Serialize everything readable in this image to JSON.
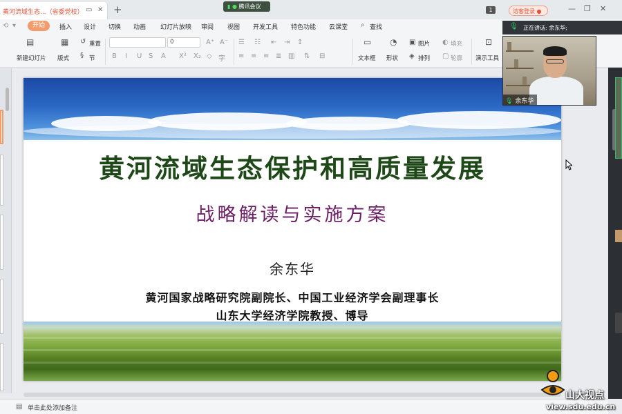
{
  "titlebar": {
    "doc_tab": "黄河流域生态...（省委党校）",
    "new_tab": "+",
    "meeting_badge": "腾讯会议",
    "page_badge": "1",
    "visitor_login": "访客登录"
  },
  "ribbon": {
    "menu": [
      "开始",
      "插入",
      "设计",
      "切换",
      "动画",
      "幻灯片放映",
      "审阅",
      "视图",
      "开发工具",
      "特色功能",
      "云课堂",
      "查找"
    ],
    "active_menu": "开始",
    "tools": {
      "new_slide": "新建幻灯片",
      "layout": "版式",
      "reset": "重置",
      "section": "节",
      "font_size": "0",
      "textbox": "文本框",
      "shape": "形状",
      "picture": "图片",
      "arrange": "排列",
      "fill": "填充",
      "outline": "轮廓",
      "present": "演示工具"
    }
  },
  "meeting": {
    "speaking": "正在讲话: 余东华;",
    "camera_name": "余东华"
  },
  "slide": {
    "title": "黄河流域生态保护和高质量发展",
    "subtitle": "战略解读与实施方案",
    "author": "余东华",
    "affiliation_1": "黄河国家战略研究院副院长、中国工业经济学会副理事长",
    "affiliation_2": "山东大学经济学院教授、博导"
  },
  "status": {
    "notes_placeholder": "单击此处添加备注"
  },
  "watermark": {
    "name": "山大视点",
    "url": "view.sdu.edu.cn"
  },
  "colors": {
    "accent": "#f39c6b",
    "title_green": "#1f4818",
    "subtitle_purple": "#6b2165"
  },
  "icons": [
    "close-icon",
    "cast-icon",
    "new-slide-icon",
    "layout-icon",
    "reset-icon",
    "section-icon",
    "bold-icon",
    "italic-icon",
    "underline-icon",
    "strikethrough-icon",
    "font-color-icon",
    "search-icon",
    "mic-icon",
    "notes-icon"
  ]
}
